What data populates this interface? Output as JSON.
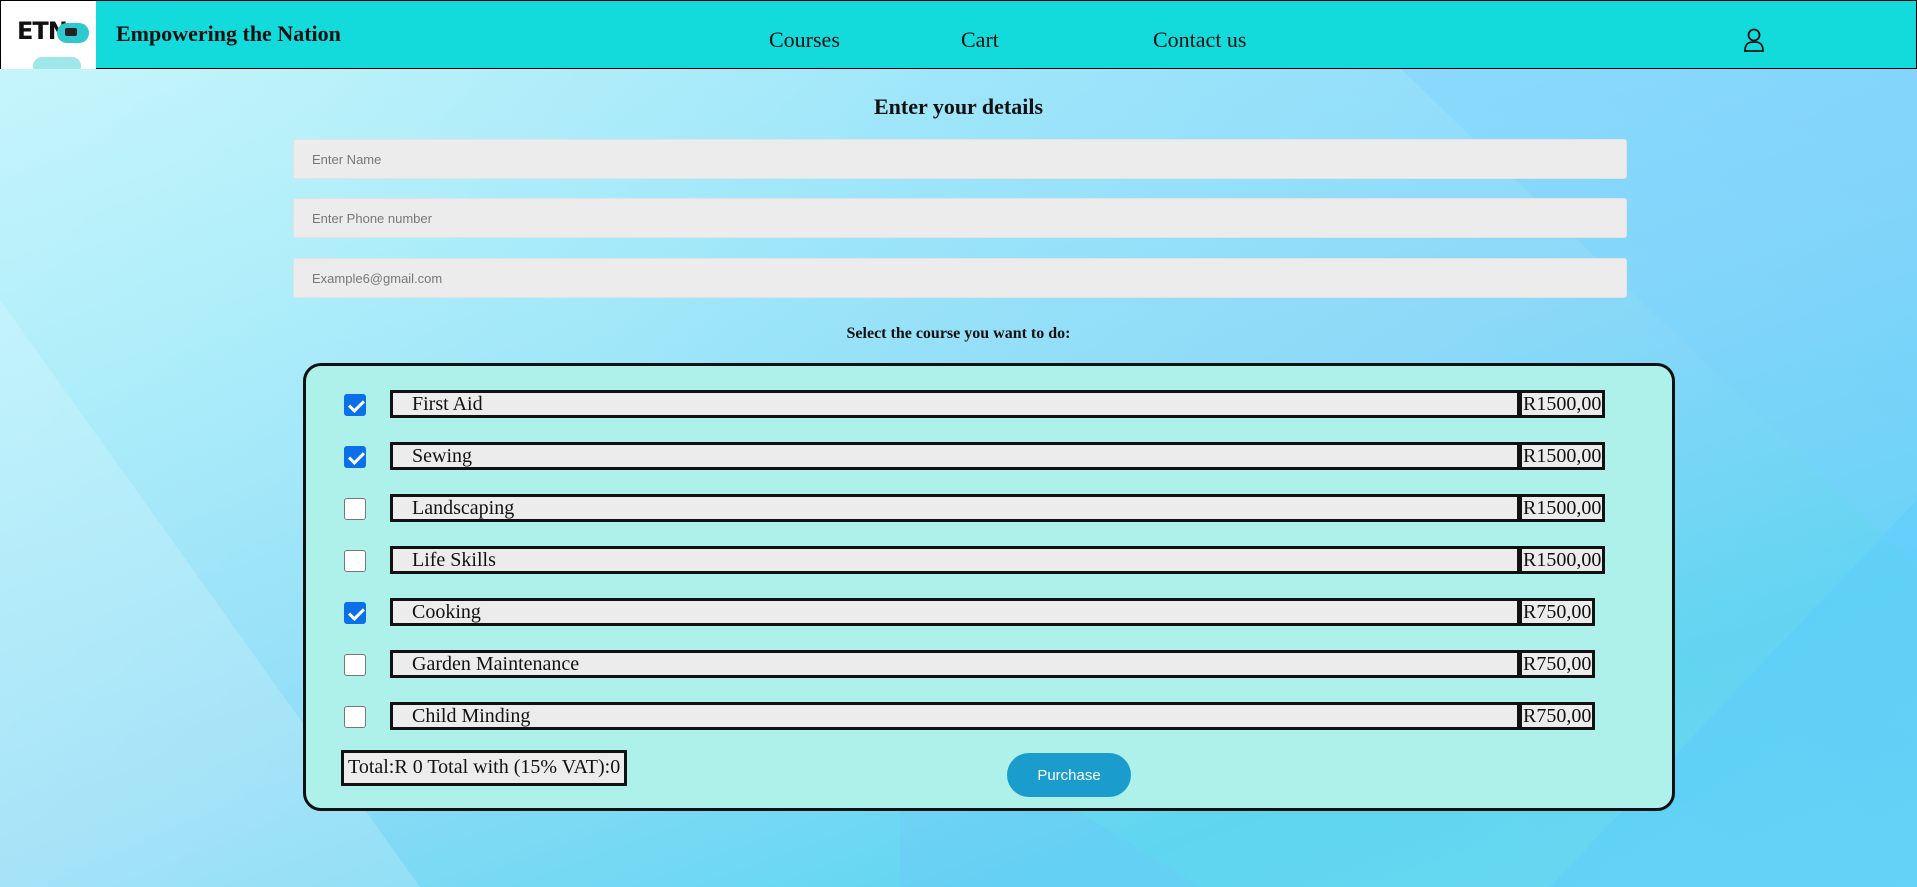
{
  "header": {
    "logo_text": "ETN",
    "brand": "Empowering the Nation",
    "nav": [
      {
        "label": "Courses"
      },
      {
        "label": "Cart"
      },
      {
        "label": "Contact us"
      }
    ],
    "user_icon": "user-icon"
  },
  "form": {
    "title": "Enter your details",
    "name_placeholder": "Enter Name",
    "phone_placeholder": "Enter Phone number",
    "email_placeholder": "Example6@gmail.com"
  },
  "courses": {
    "label": "Select the course you want to do:",
    "items": [
      {
        "name": "First Aid",
        "price": "R1500,00",
        "checked": true
      },
      {
        "name": "Sewing",
        "price": "R1500,00",
        "checked": true
      },
      {
        "name": "Landscaping",
        "price": "R1500,00",
        "checked": false
      },
      {
        "name": "Life Skills",
        "price": "R1500,00",
        "checked": false
      },
      {
        "name": "Cooking",
        "price": "R750,00",
        "checked": true
      },
      {
        "name": "Garden Maintenance",
        "price": "R750,00",
        "checked": false
      },
      {
        "name": "Child Minding",
        "price": "R750,00",
        "checked": false
      }
    ],
    "total_text": "Total:R 0 Total with (15% VAT):0",
    "purchase_label": "Purchase"
  },
  "colors": {
    "header_bg": "#13dbdc",
    "panel_bg": "#aef0ea",
    "checkbox_accent": "#0a6fe8",
    "button_bg": "#1a9ccc"
  }
}
